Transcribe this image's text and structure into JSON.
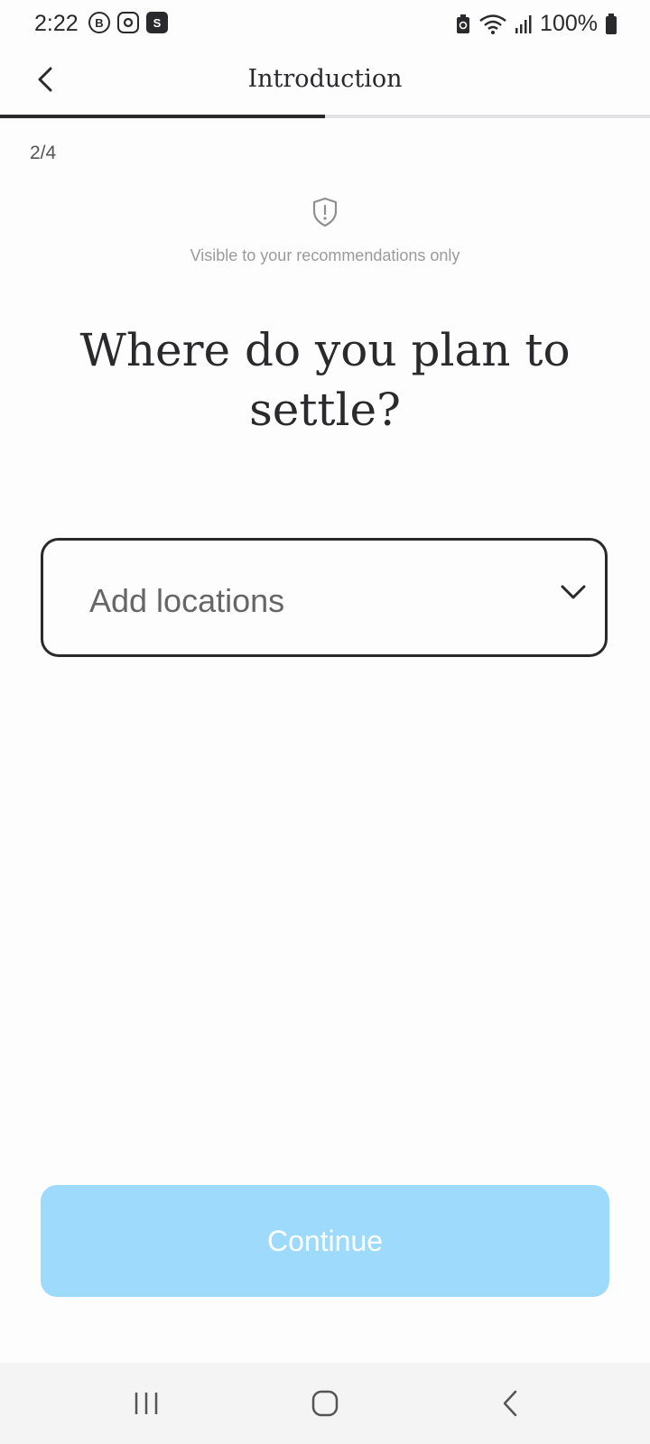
{
  "status_bar": {
    "time": "2:22",
    "app_icons": [
      {
        "name": "b-chat-icon",
        "glyph": "B"
      },
      {
        "name": "instagram-icon",
        "glyph": ""
      },
      {
        "name": "s-app-icon",
        "glyph": "S"
      }
    ],
    "battery_text": "100%"
  },
  "header": {
    "title": "Introduction",
    "progress_fraction": 0.5
  },
  "step_counter": "2/4",
  "privacy_note": "Visible to your recommendations only",
  "question": "Where do you plan to settle?",
  "location_select": {
    "placeholder": "Add locations"
  },
  "continue_label": "Continue",
  "colors": {
    "continue_button": "#9ddafb",
    "text_primary": "#2a2a2c",
    "progress_track": "#e3e3e6"
  }
}
